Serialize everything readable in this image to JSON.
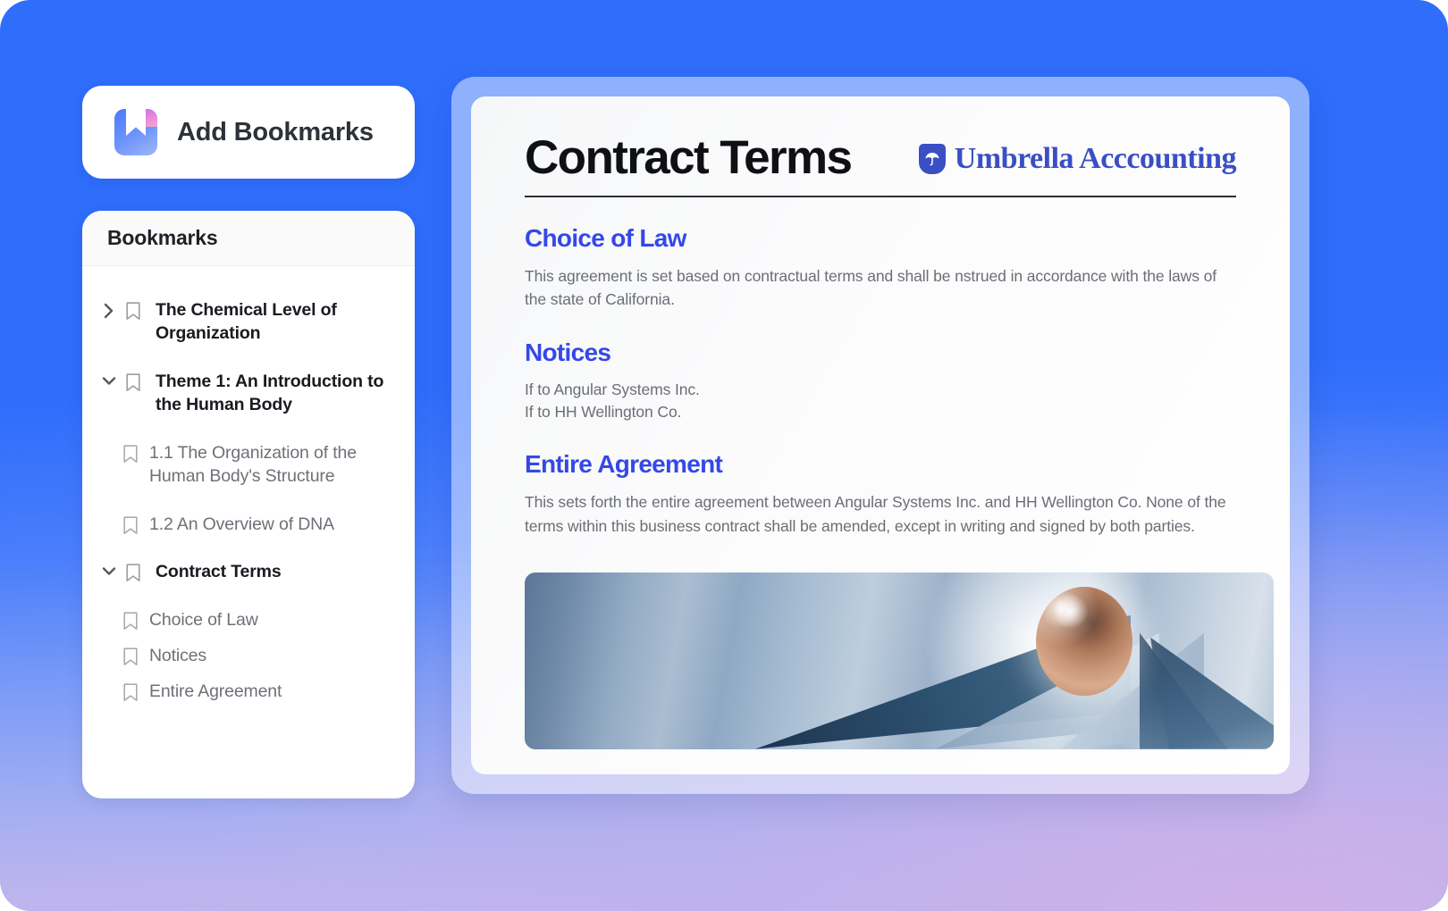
{
  "sidebar": {
    "add_button": {
      "label": "Add Bookmarks",
      "icon": "bookmark-app-icon"
    },
    "panel_title": "Bookmarks",
    "items": [
      {
        "label": "The Chemical Level of Organization",
        "level": 1,
        "expanded": false,
        "chevron": "chevron-right-icon",
        "icon": "bookmark-icon"
      },
      {
        "label": "Theme 1: An Introduction to the Human Body",
        "level": 1,
        "expanded": true,
        "chevron": "chevron-down-icon",
        "icon": "bookmark-icon"
      },
      {
        "label": "1.1 The Organization of the Human Body's Structure",
        "level": 2,
        "icon": "bookmark-icon"
      },
      {
        "label": "1.2 An Overview of DNA",
        "level": 2,
        "icon": "bookmark-icon"
      },
      {
        "label": "Contract Terms",
        "level": 1,
        "expanded": true,
        "chevron": "chevron-down-icon",
        "icon": "bookmark-icon"
      },
      {
        "label": "Choice of Law",
        "level": 2,
        "icon": "bookmark-icon"
      },
      {
        "label": "Notices",
        "level": 2,
        "icon": "bookmark-icon"
      },
      {
        "label": "Entire Agreement",
        "level": 2,
        "icon": "bookmark-icon"
      }
    ]
  },
  "document": {
    "title": "Contract Terms",
    "brand": {
      "name": "Umbrella Acccounting",
      "icon": "umbrella-badge-icon",
      "color": "#3a4fc4"
    },
    "accent_color": "#3448e8",
    "sections": [
      {
        "heading": "Choice of Law",
        "body": "This agreement is set based on contractual terms and shall be nstrued in accordance with the laws of the state of California."
      },
      {
        "heading": "Notices",
        "lines": [
          "If to Angular Systems Inc.",
          "If to HH Wellington Co."
        ]
      },
      {
        "heading": "Entire Agreement",
        "body": "This sets forth the entire agreement between Angular Systems Inc. and HH Wellington Co. None of the terms within this business contract shall be amended, except in writing and signed by both parties."
      }
    ],
    "artwork": {
      "name": "abstract-sphere-prism-image"
    }
  }
}
